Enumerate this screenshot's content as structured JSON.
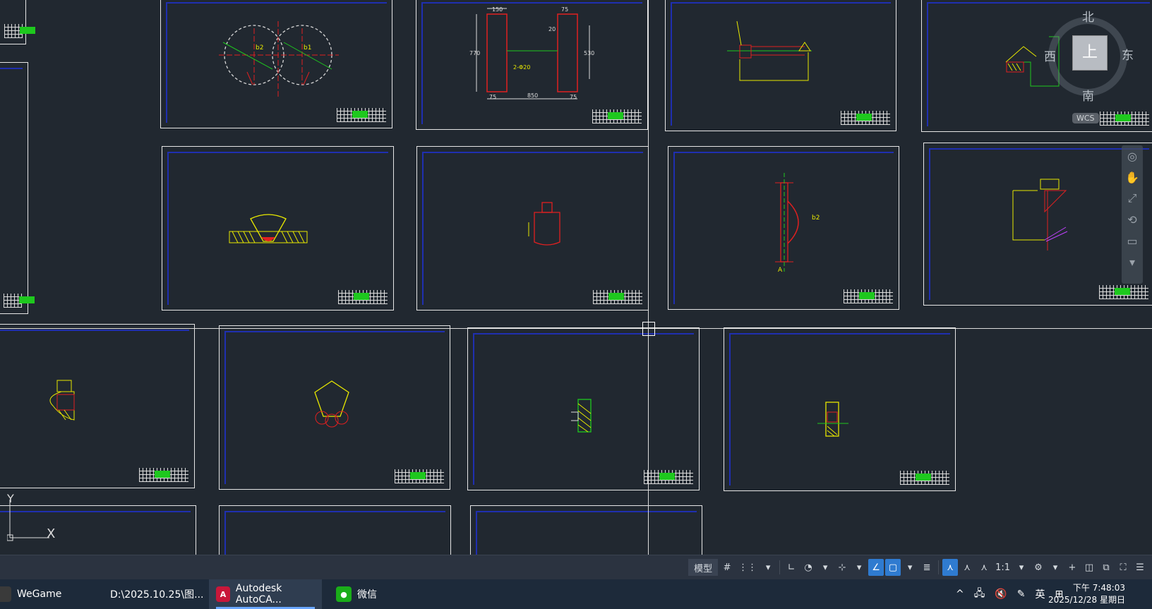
{
  "viewcube": {
    "north": "北",
    "south": "南",
    "east": "东",
    "west": "西",
    "face": "上",
    "wcs": "WCS"
  },
  "ucs": {
    "x_label": "X",
    "y_label": "Y"
  },
  "drawing_labels": {
    "dim_150": "150",
    "dim_75_top": "75",
    "dim_770": "770",
    "dim_530": "530",
    "dim_75_a": "75",
    "dim_850": "850",
    "dim_75_b": "75",
    "dim_20": "20",
    "phi20": "2-Φ20",
    "label_b2_a": "b2",
    "label_b1": "b1",
    "label_b2_b": "b2",
    "label_a": "A"
  },
  "statusbar": {
    "model_tab": "模型",
    "scale": "1:1",
    "icons": [
      "grid-icon",
      "snap-icon",
      "ortho-icon",
      "polar-icon",
      "osnap-icon",
      "dynamic-input-icon",
      "lineweight-icon",
      "annotation-icon",
      "workspace-icon",
      "gear-icon",
      "plus-icon",
      "isolate-icon",
      "hardware-icon",
      "fullscreen-icon",
      "menu-icon"
    ]
  },
  "taskbar": {
    "apps": [
      {
        "label": "WeGame",
        "icon": "wegame-icon"
      },
      {
        "label": "D:\\2025.10.25\\图...",
        "icon": "folder-icon"
      },
      {
        "label": "Autodesk AutoCA...",
        "icon": "autocad-icon",
        "active": true
      },
      {
        "label": "微信",
        "icon": "wechat-icon"
      }
    ],
    "tray": {
      "ime": "英",
      "time": "下午 7:48:03",
      "date": "2025/12/28 星期日"
    }
  },
  "colors": {
    "background": "#212830",
    "sheet_border": "#e6e6e6",
    "inner_frame": "#1f2fb0",
    "accent": "#2f7bd0",
    "drawing_red": "#e02020",
    "drawing_yellow": "#e8e800",
    "drawing_green": "#1ec81e"
  }
}
